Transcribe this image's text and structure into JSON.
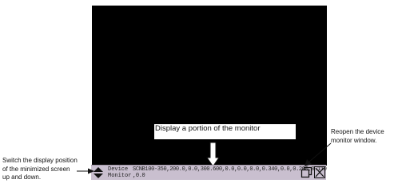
{
  "callouts": {
    "center": "Display a portion of the monitor",
    "left": "Switch the display position of the minimized screen up and down.",
    "right": "Reopen the device monitor window."
  },
  "taskbar": {
    "label_line1": "Device",
    "label_line2": "Monitor",
    "data_line1": "SCNB100-350,200.0,0.0,300.600,0.0,0.0,0.0,0.340,0.0,0.200,0.110",
    "data_line2": ",0.0"
  },
  "colors": {
    "screen": "#000000",
    "taskbar": "#c9bfcf"
  },
  "icons": {
    "updown": "up-down-triangle-icon",
    "reopen": "restore-window-icon",
    "close": "close-x-icon"
  }
}
